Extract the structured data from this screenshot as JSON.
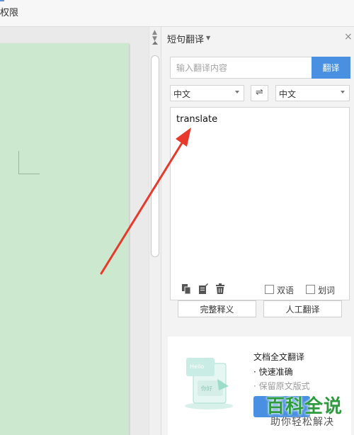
{
  "ribbon": {
    "partial_label": "权限"
  },
  "panel": {
    "title": "短句翻译",
    "close_glyph": "×",
    "search": {
      "placeholder": "输入翻译内容",
      "value": ""
    },
    "translate_button": "翻译",
    "source_language": "中文",
    "target_language": "中文",
    "swap_glyph": "⇌",
    "source_text": "translate",
    "bilingual_label": "双语",
    "word_select_label": "划词",
    "full_definition_button": "完整释义",
    "human_translation_button": "人工翻译"
  },
  "promo": {
    "title": "文档全文翻译",
    "bullet_1": "· 快速准确",
    "bullet_2": "· 保留原文版式",
    "illustration_text_1": "Hello",
    "illustration_text_2": "你好"
  },
  "watermark": {
    "main": "百科全说",
    "sub": "助你轻松解决"
  },
  "colors": {
    "accent": "#4a90e2",
    "page_green": "#cce8cf",
    "arrow_red": "#e8392b",
    "watermark_green": "#2e9c3e"
  }
}
